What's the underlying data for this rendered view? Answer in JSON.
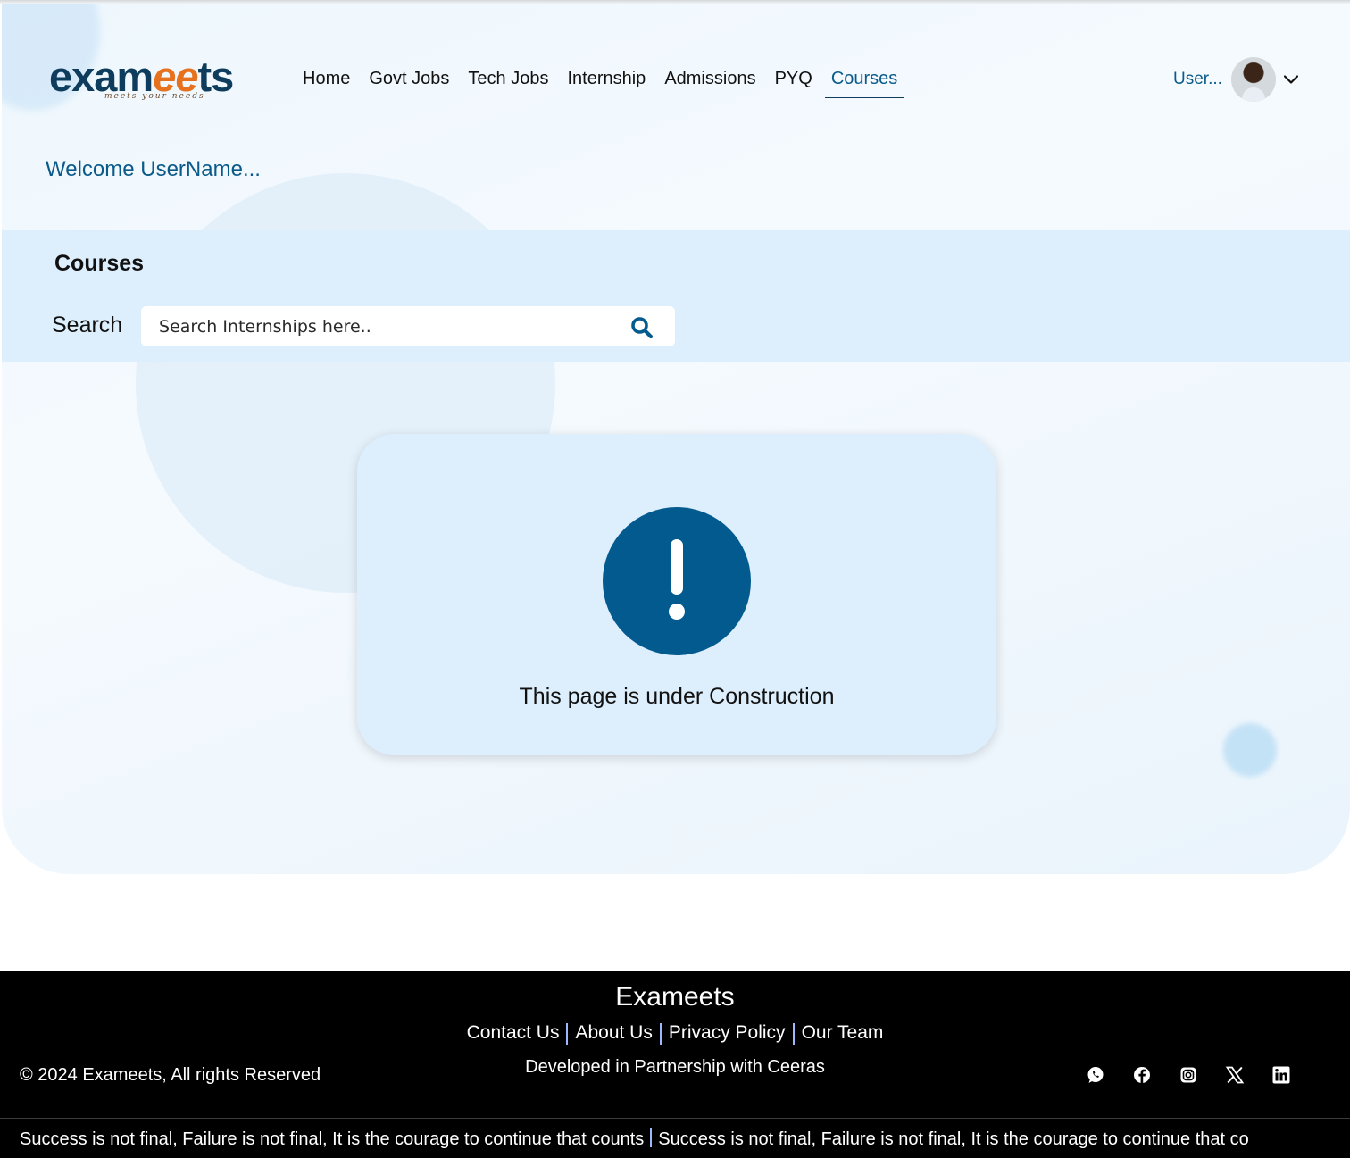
{
  "brand": {
    "logo_text_a": "exam",
    "logo_text_b": "ee",
    "logo_text_c": "ts",
    "tagline": "meets your needs"
  },
  "nav": {
    "items": [
      {
        "label": "Home"
      },
      {
        "label": "Govt Jobs"
      },
      {
        "label": "Tech Jobs"
      },
      {
        "label": "Internship"
      },
      {
        "label": "Admissions"
      },
      {
        "label": "PYQ"
      },
      {
        "label": "Courses",
        "active": true
      }
    ]
  },
  "user": {
    "name": "User...",
    "avatar_icon": "avatar",
    "menu_icon": "chevron-down-icon"
  },
  "welcome": "Welcome UserName...",
  "section": {
    "title": "Courses",
    "search_label": "Search",
    "search_placeholder": "Search Internships here..",
    "search_icon": "search-icon"
  },
  "notice": {
    "icon": "exclamation-circle-icon",
    "message": "This page is under Construction"
  },
  "footer": {
    "brand": "Exameets",
    "links": [
      "Contact Us",
      "About Us",
      "Privacy Policy",
      "Our Team"
    ],
    "developed": "Developed in Partnership with Ceeras",
    "copyright": "© 2024 Exameets, All rights Reserved",
    "social": [
      "whatsapp-icon",
      "facebook-icon",
      "instagram-icon",
      "x-icon",
      "linkedin-icon"
    ],
    "ticker_a": "Success is not final, Failure is not final, It is the courage to continue that counts",
    "ticker_b": "Success is not final, Failure is not final, It is the courage to continue that co"
  },
  "colors": {
    "primary": "#035a8f",
    "accent": "#e6711e",
    "band": "#ddeefc",
    "footer": "#000000"
  }
}
